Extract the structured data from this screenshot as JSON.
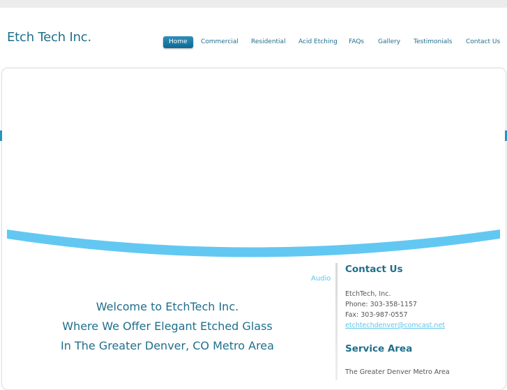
{
  "site": {
    "title": "Etch Tech Inc."
  },
  "nav": {
    "items": [
      {
        "label": "Home",
        "active": true
      },
      {
        "label": "Commercial",
        "active": false
      },
      {
        "label": "Residential",
        "active": false
      },
      {
        "label": "Acid Etching",
        "active": false
      },
      {
        "label": "FAQs",
        "active": false
      },
      {
        "label": "Gallery",
        "active": false
      },
      {
        "label": "Testimonials",
        "active": false
      },
      {
        "label": "Contact Us",
        "active": false
      }
    ]
  },
  "main": {
    "audio_label": "Audio",
    "welcome_lines": [
      "Welcome to EtchTech Inc.",
      "Where We Offer Elegant Etched Glass",
      "In The Greater Denver, CO Metro Area"
    ]
  },
  "sidebar": {
    "contact_heading": "Contact Us",
    "company": "EtchTech, Inc.",
    "phone": "Phone: 303-358-1157",
    "fax": "Fax: 303-987-0557",
    "email": "etchtechdenver@comcast.net",
    "service_heading": "Service Area",
    "service_text": "The Greater Denver Metro Area"
  },
  "colors": {
    "brand": "#1f6f8b",
    "accent": "#5ec6e8",
    "nav_active": "#1675a3",
    "banner_swoosh": "#62c8f2"
  }
}
